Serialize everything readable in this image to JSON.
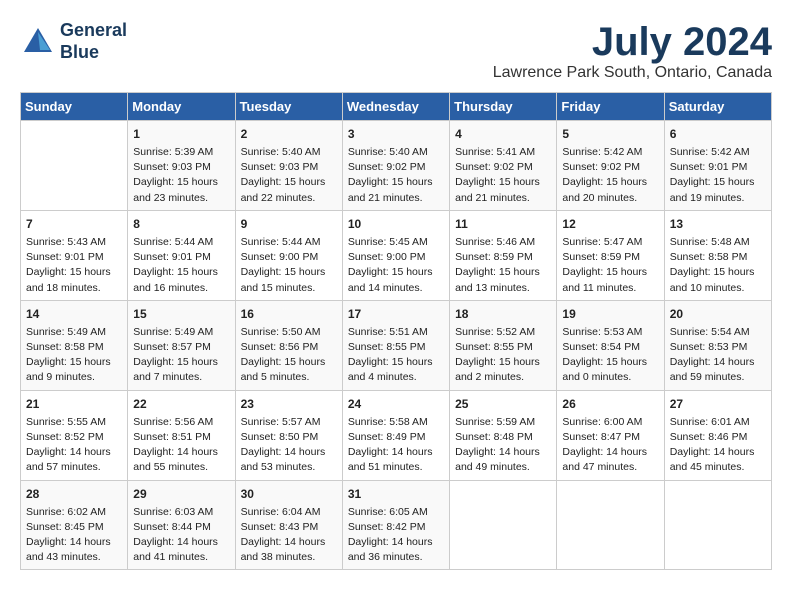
{
  "header": {
    "logo_line1": "General",
    "logo_line2": "Blue",
    "month_title": "July 2024",
    "location": "Lawrence Park South, Ontario, Canada"
  },
  "days_of_week": [
    "Sunday",
    "Monday",
    "Tuesday",
    "Wednesday",
    "Thursday",
    "Friday",
    "Saturday"
  ],
  "weeks": [
    [
      {
        "day": "",
        "content": ""
      },
      {
        "day": "1",
        "content": "Sunrise: 5:39 AM\nSunset: 9:03 PM\nDaylight: 15 hours\nand 23 minutes."
      },
      {
        "day": "2",
        "content": "Sunrise: 5:40 AM\nSunset: 9:03 PM\nDaylight: 15 hours\nand 22 minutes."
      },
      {
        "day": "3",
        "content": "Sunrise: 5:40 AM\nSunset: 9:02 PM\nDaylight: 15 hours\nand 21 minutes."
      },
      {
        "day": "4",
        "content": "Sunrise: 5:41 AM\nSunset: 9:02 PM\nDaylight: 15 hours\nand 21 minutes."
      },
      {
        "day": "5",
        "content": "Sunrise: 5:42 AM\nSunset: 9:02 PM\nDaylight: 15 hours\nand 20 minutes."
      },
      {
        "day": "6",
        "content": "Sunrise: 5:42 AM\nSunset: 9:01 PM\nDaylight: 15 hours\nand 19 minutes."
      }
    ],
    [
      {
        "day": "7",
        "content": "Sunrise: 5:43 AM\nSunset: 9:01 PM\nDaylight: 15 hours\nand 18 minutes."
      },
      {
        "day": "8",
        "content": "Sunrise: 5:44 AM\nSunset: 9:01 PM\nDaylight: 15 hours\nand 16 minutes."
      },
      {
        "day": "9",
        "content": "Sunrise: 5:44 AM\nSunset: 9:00 PM\nDaylight: 15 hours\nand 15 minutes."
      },
      {
        "day": "10",
        "content": "Sunrise: 5:45 AM\nSunset: 9:00 PM\nDaylight: 15 hours\nand 14 minutes."
      },
      {
        "day": "11",
        "content": "Sunrise: 5:46 AM\nSunset: 8:59 PM\nDaylight: 15 hours\nand 13 minutes."
      },
      {
        "day": "12",
        "content": "Sunrise: 5:47 AM\nSunset: 8:59 PM\nDaylight: 15 hours\nand 11 minutes."
      },
      {
        "day": "13",
        "content": "Sunrise: 5:48 AM\nSunset: 8:58 PM\nDaylight: 15 hours\nand 10 minutes."
      }
    ],
    [
      {
        "day": "14",
        "content": "Sunrise: 5:49 AM\nSunset: 8:58 PM\nDaylight: 15 hours\nand 9 minutes."
      },
      {
        "day": "15",
        "content": "Sunrise: 5:49 AM\nSunset: 8:57 PM\nDaylight: 15 hours\nand 7 minutes."
      },
      {
        "day": "16",
        "content": "Sunrise: 5:50 AM\nSunset: 8:56 PM\nDaylight: 15 hours\nand 5 minutes."
      },
      {
        "day": "17",
        "content": "Sunrise: 5:51 AM\nSunset: 8:55 PM\nDaylight: 15 hours\nand 4 minutes."
      },
      {
        "day": "18",
        "content": "Sunrise: 5:52 AM\nSunset: 8:55 PM\nDaylight: 15 hours\nand 2 minutes."
      },
      {
        "day": "19",
        "content": "Sunrise: 5:53 AM\nSunset: 8:54 PM\nDaylight: 15 hours\nand 0 minutes."
      },
      {
        "day": "20",
        "content": "Sunrise: 5:54 AM\nSunset: 8:53 PM\nDaylight: 14 hours\nand 59 minutes."
      }
    ],
    [
      {
        "day": "21",
        "content": "Sunrise: 5:55 AM\nSunset: 8:52 PM\nDaylight: 14 hours\nand 57 minutes."
      },
      {
        "day": "22",
        "content": "Sunrise: 5:56 AM\nSunset: 8:51 PM\nDaylight: 14 hours\nand 55 minutes."
      },
      {
        "day": "23",
        "content": "Sunrise: 5:57 AM\nSunset: 8:50 PM\nDaylight: 14 hours\nand 53 minutes."
      },
      {
        "day": "24",
        "content": "Sunrise: 5:58 AM\nSunset: 8:49 PM\nDaylight: 14 hours\nand 51 minutes."
      },
      {
        "day": "25",
        "content": "Sunrise: 5:59 AM\nSunset: 8:48 PM\nDaylight: 14 hours\nand 49 minutes."
      },
      {
        "day": "26",
        "content": "Sunrise: 6:00 AM\nSunset: 8:47 PM\nDaylight: 14 hours\nand 47 minutes."
      },
      {
        "day": "27",
        "content": "Sunrise: 6:01 AM\nSunset: 8:46 PM\nDaylight: 14 hours\nand 45 minutes."
      }
    ],
    [
      {
        "day": "28",
        "content": "Sunrise: 6:02 AM\nSunset: 8:45 PM\nDaylight: 14 hours\nand 43 minutes."
      },
      {
        "day": "29",
        "content": "Sunrise: 6:03 AM\nSunset: 8:44 PM\nDaylight: 14 hours\nand 41 minutes."
      },
      {
        "day": "30",
        "content": "Sunrise: 6:04 AM\nSunset: 8:43 PM\nDaylight: 14 hours\nand 38 minutes."
      },
      {
        "day": "31",
        "content": "Sunrise: 6:05 AM\nSunset: 8:42 PM\nDaylight: 14 hours\nand 36 minutes."
      },
      {
        "day": "",
        "content": ""
      },
      {
        "day": "",
        "content": ""
      },
      {
        "day": "",
        "content": ""
      }
    ]
  ]
}
